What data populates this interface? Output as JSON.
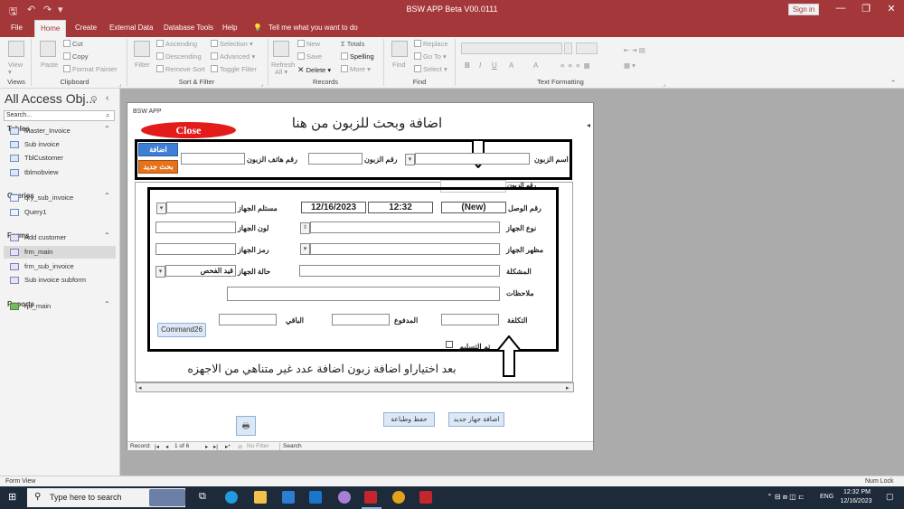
{
  "window": {
    "title": "BSW APP  Beta V00.0111",
    "sign_in": "Sign in",
    "minimize": "—",
    "restore": "❐",
    "close": "✕"
  },
  "tabs": [
    "File",
    "Home",
    "Create",
    "External Data",
    "Database Tools",
    "Help"
  ],
  "tell_me": "Tell me what you want to do",
  "ribbon": {
    "views": {
      "view": "View",
      "group": "Views"
    },
    "clipboard": {
      "paste": "Paste",
      "cut": "Cut",
      "copy": "Copy",
      "format_painter": "Format Painter",
      "group": "Clipboard"
    },
    "sort_filter": {
      "filter": "Filter",
      "ascending": "Ascending",
      "descending": "Descending",
      "remove_sort": "Remove Sort",
      "selection": "Selection",
      "advanced": "Advanced",
      "toggle_filter": "Toggle Filter",
      "group": "Sort & Filter"
    },
    "records": {
      "refresh": "Refresh",
      "all": "All",
      "new": "New",
      "save": "Save",
      "delete": "Delete",
      "totals": "Totals",
      "spelling": "Spelling",
      "more": "More",
      "group": "Records"
    },
    "find": {
      "find": "Find",
      "replace": "Replace",
      "go_to": "Go To",
      "select": "Select",
      "group": "Find"
    },
    "text_formatting": {
      "bold": "B",
      "italic": "I",
      "underline": "U",
      "font_color": "A",
      "highlight": "A",
      "group": "Text Formatting"
    }
  },
  "nav": {
    "header": "All Access Obj...",
    "search_placeholder": "Search...",
    "sections": [
      {
        "name": "Tables",
        "items": [
          "Master_Invoice",
          "Sub invoice",
          "TblCustomer",
          "tblmobview"
        ]
      },
      {
        "name": "Queries",
        "items": [
          "qry_sub_invoice",
          "Query1"
        ]
      },
      {
        "name": "Forms",
        "items": [
          "Add customer",
          "frm_main",
          "frm_sub_invoice",
          "Sub invoice subform"
        ]
      },
      {
        "name": "Reports",
        "items": [
          "rpt_main"
        ]
      }
    ]
  },
  "form": {
    "caption": "BSW APP",
    "close_button": "Close",
    "heading_top": "اضافة وبحث للزبون من هنا",
    "heading_bottom": "بعد اختياراو اضافة زبون اضافة عدد غير متناهي من الاجهزه",
    "add_button": "اضافة",
    "new_search_button": "بحث جديد",
    "customer_name_label": "اسم الزبون",
    "customer_no_label": "رقم الزبون",
    "customer_phone_label": "رقم هاتف الزبون",
    "customer_no_label_2": "رقم الزبون",
    "receipt_no_label": "رقم الوصل",
    "receipt_no_value": "(New)",
    "time_value": "12:32",
    "date_value": "12/16/2023",
    "receiver_label": "مستلم الجهاز",
    "device_type_label": "نوع الجهاز",
    "device_color_label": "لون الجهاز",
    "device_look_label": "مظهر الجهاز",
    "device_code_label": "رمز الجهاز",
    "problem_label": "المشكلة",
    "device_status_label": "حالة الجهاز",
    "device_status_value": "قيد الفحص",
    "notes_label": "ملاحظات",
    "cost_label": "التكلفة",
    "paid_label": "المدفوع",
    "remaining_label": "الباقي",
    "delivered_label": "تم التسليم",
    "command_button": "Command26",
    "save_print_button": "حفظ وطباعة",
    "add_device_button": "اضافة جهاز جديد",
    "record_nav": {
      "label": "Record:",
      "position": "1 of 6",
      "no_filter": "No Filter",
      "search": "Search"
    }
  },
  "status": {
    "left": "Form View",
    "right": "Num Lock"
  },
  "taskbar": {
    "search_placeholder": "Type here to search",
    "lang": "ENG",
    "time": "12:32 PM",
    "date": "12/16/2023"
  }
}
